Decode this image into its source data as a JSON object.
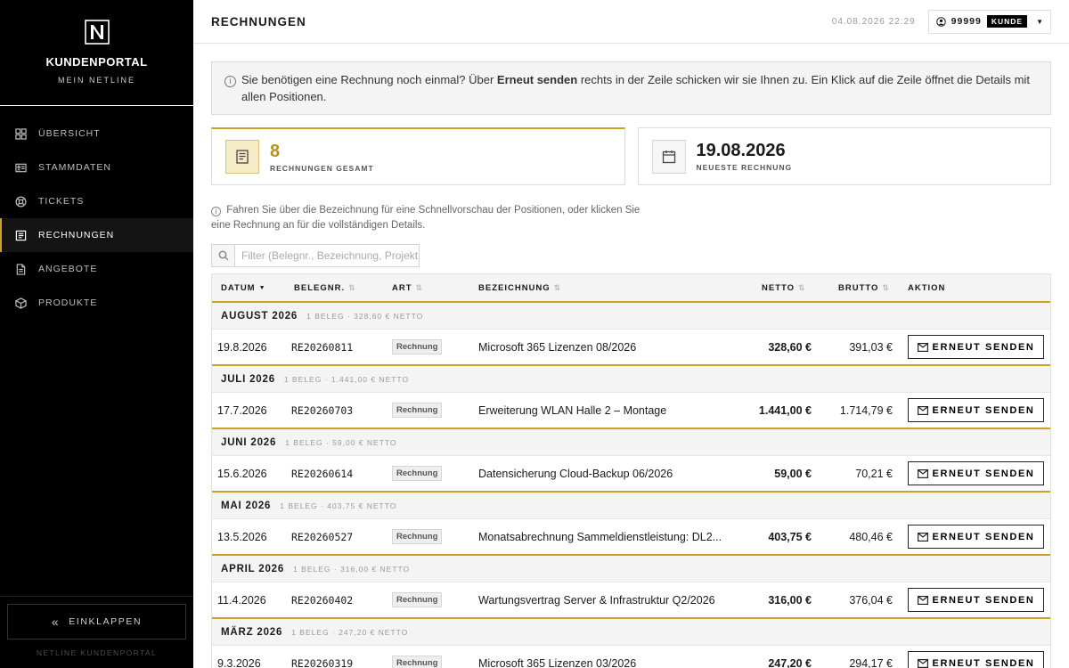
{
  "sidebar": {
    "brand_title": "KUNDENPORTAL",
    "brand_sub": "MEIN NETLINE",
    "items": [
      {
        "label": "ÜBERSICHT",
        "icon": "grid-icon",
        "active": false
      },
      {
        "label": "STAMMDATEN",
        "icon": "id-card-icon",
        "active": false
      },
      {
        "label": "TICKETS",
        "icon": "lifebuoy-icon",
        "active": false
      },
      {
        "label": "RECHNUNGEN",
        "icon": "invoice-icon",
        "active": true
      },
      {
        "label": "ANGEBOTE",
        "icon": "document-icon",
        "active": false
      },
      {
        "label": "PRODUKTE",
        "icon": "box-icon",
        "active": false
      }
    ],
    "collapse_label": "EINKLAPPEN",
    "footer": "NETLINE KUNDENPORTAL"
  },
  "topbar": {
    "title": "RECHNUNGEN",
    "datetime": "04.08.2026 22:29",
    "user_id": "99999",
    "role": "KUNDE"
  },
  "notice": {
    "text_before": "Sie benötigen eine Rechnung noch einmal? Über ",
    "bold": "Erneut senden",
    "text_after": " rechts in der Zeile schicken wir sie Ihnen zu. Ein Klick auf die Zeile öffnet die Details mit allen Positionen."
  },
  "stats": [
    {
      "value": "8",
      "label": "RECHNUNGEN GESAMT",
      "icon": "invoice-icon"
    },
    {
      "value": "19.08.2026",
      "label": "NEUESTE RECHNUNG",
      "icon": "calendar-icon"
    }
  ],
  "hint": "Fahren Sie über die Bezeichnung für eine Schnellvorschau der Positionen, oder klicken Sie eine Rechnung an für die vollständigen Details.",
  "search": {
    "placeholder": "Filter (Belegnr., Bezeichnung, Projekt)"
  },
  "table": {
    "headers": {
      "date": "DATUM",
      "number": "BELEGNR.",
      "type": "ART",
      "description": "BEZEICHNUNG",
      "net": "NETTO",
      "gross": "BRUTTO",
      "action": "AKTION"
    },
    "resend_label": "ERNEUT SENDEN",
    "groups": [
      {
        "title": "AUGUST 2026",
        "meta": "1 BELEG · 328,60 € NETTO",
        "row": {
          "date": "19.8.2026",
          "number": "RE20260811",
          "type": "Rechnung",
          "description": "Microsoft 365 Lizenzen 08/2026",
          "net": "328,60 €",
          "gross": "391,03 €"
        }
      },
      {
        "title": "JULI 2026",
        "meta": "1 BELEG · 1.441,00 € NETTO",
        "row": {
          "date": "17.7.2026",
          "number": "RE20260703",
          "type": "Rechnung",
          "description": "Erweiterung WLAN Halle 2 – Montage",
          "net": "1.441,00 €",
          "gross": "1.714,79 €"
        }
      },
      {
        "title": "JUNI 2026",
        "meta": "1 BELEG · 59,00 € NETTO",
        "row": {
          "date": "15.6.2026",
          "number": "RE20260614",
          "type": "Rechnung",
          "description": "Datensicherung Cloud-Backup 06/2026",
          "net": "59,00 €",
          "gross": "70,21 €"
        }
      },
      {
        "title": "MAI 2026",
        "meta": "1 BELEG · 403,75 € NETTO",
        "row": {
          "date": "13.5.2026",
          "number": "RE20260527",
          "type": "Rechnung",
          "description": "Monatsabrechnung Sammeldienstleistung: DL2...",
          "net": "403,75 €",
          "gross": "480,46 €"
        }
      },
      {
        "title": "APRIL 2026",
        "meta": "1 BELEG · 316,00 € NETTO",
        "row": {
          "date": "11.4.2026",
          "number": "RE20260402",
          "type": "Rechnung",
          "description": "Wartungsvertrag Server & Infrastruktur Q2/2026",
          "net": "316,00 €",
          "gross": "376,04 €"
        }
      },
      {
        "title": "MÄRZ 2026",
        "meta": "1 BELEG · 247,20 € NETTO",
        "row": {
          "date": "9.3.2026",
          "number": "RE20260319",
          "type": "Rechnung",
          "description": "Microsoft 365 Lizenzen 03/2026",
          "net": "247,20 €",
          "gross": "294,17 €"
        }
      }
    ]
  },
  "colors": {
    "accent": "#c9a227",
    "sidebar": "#000000",
    "muted_bg": "#f4f4f4"
  }
}
